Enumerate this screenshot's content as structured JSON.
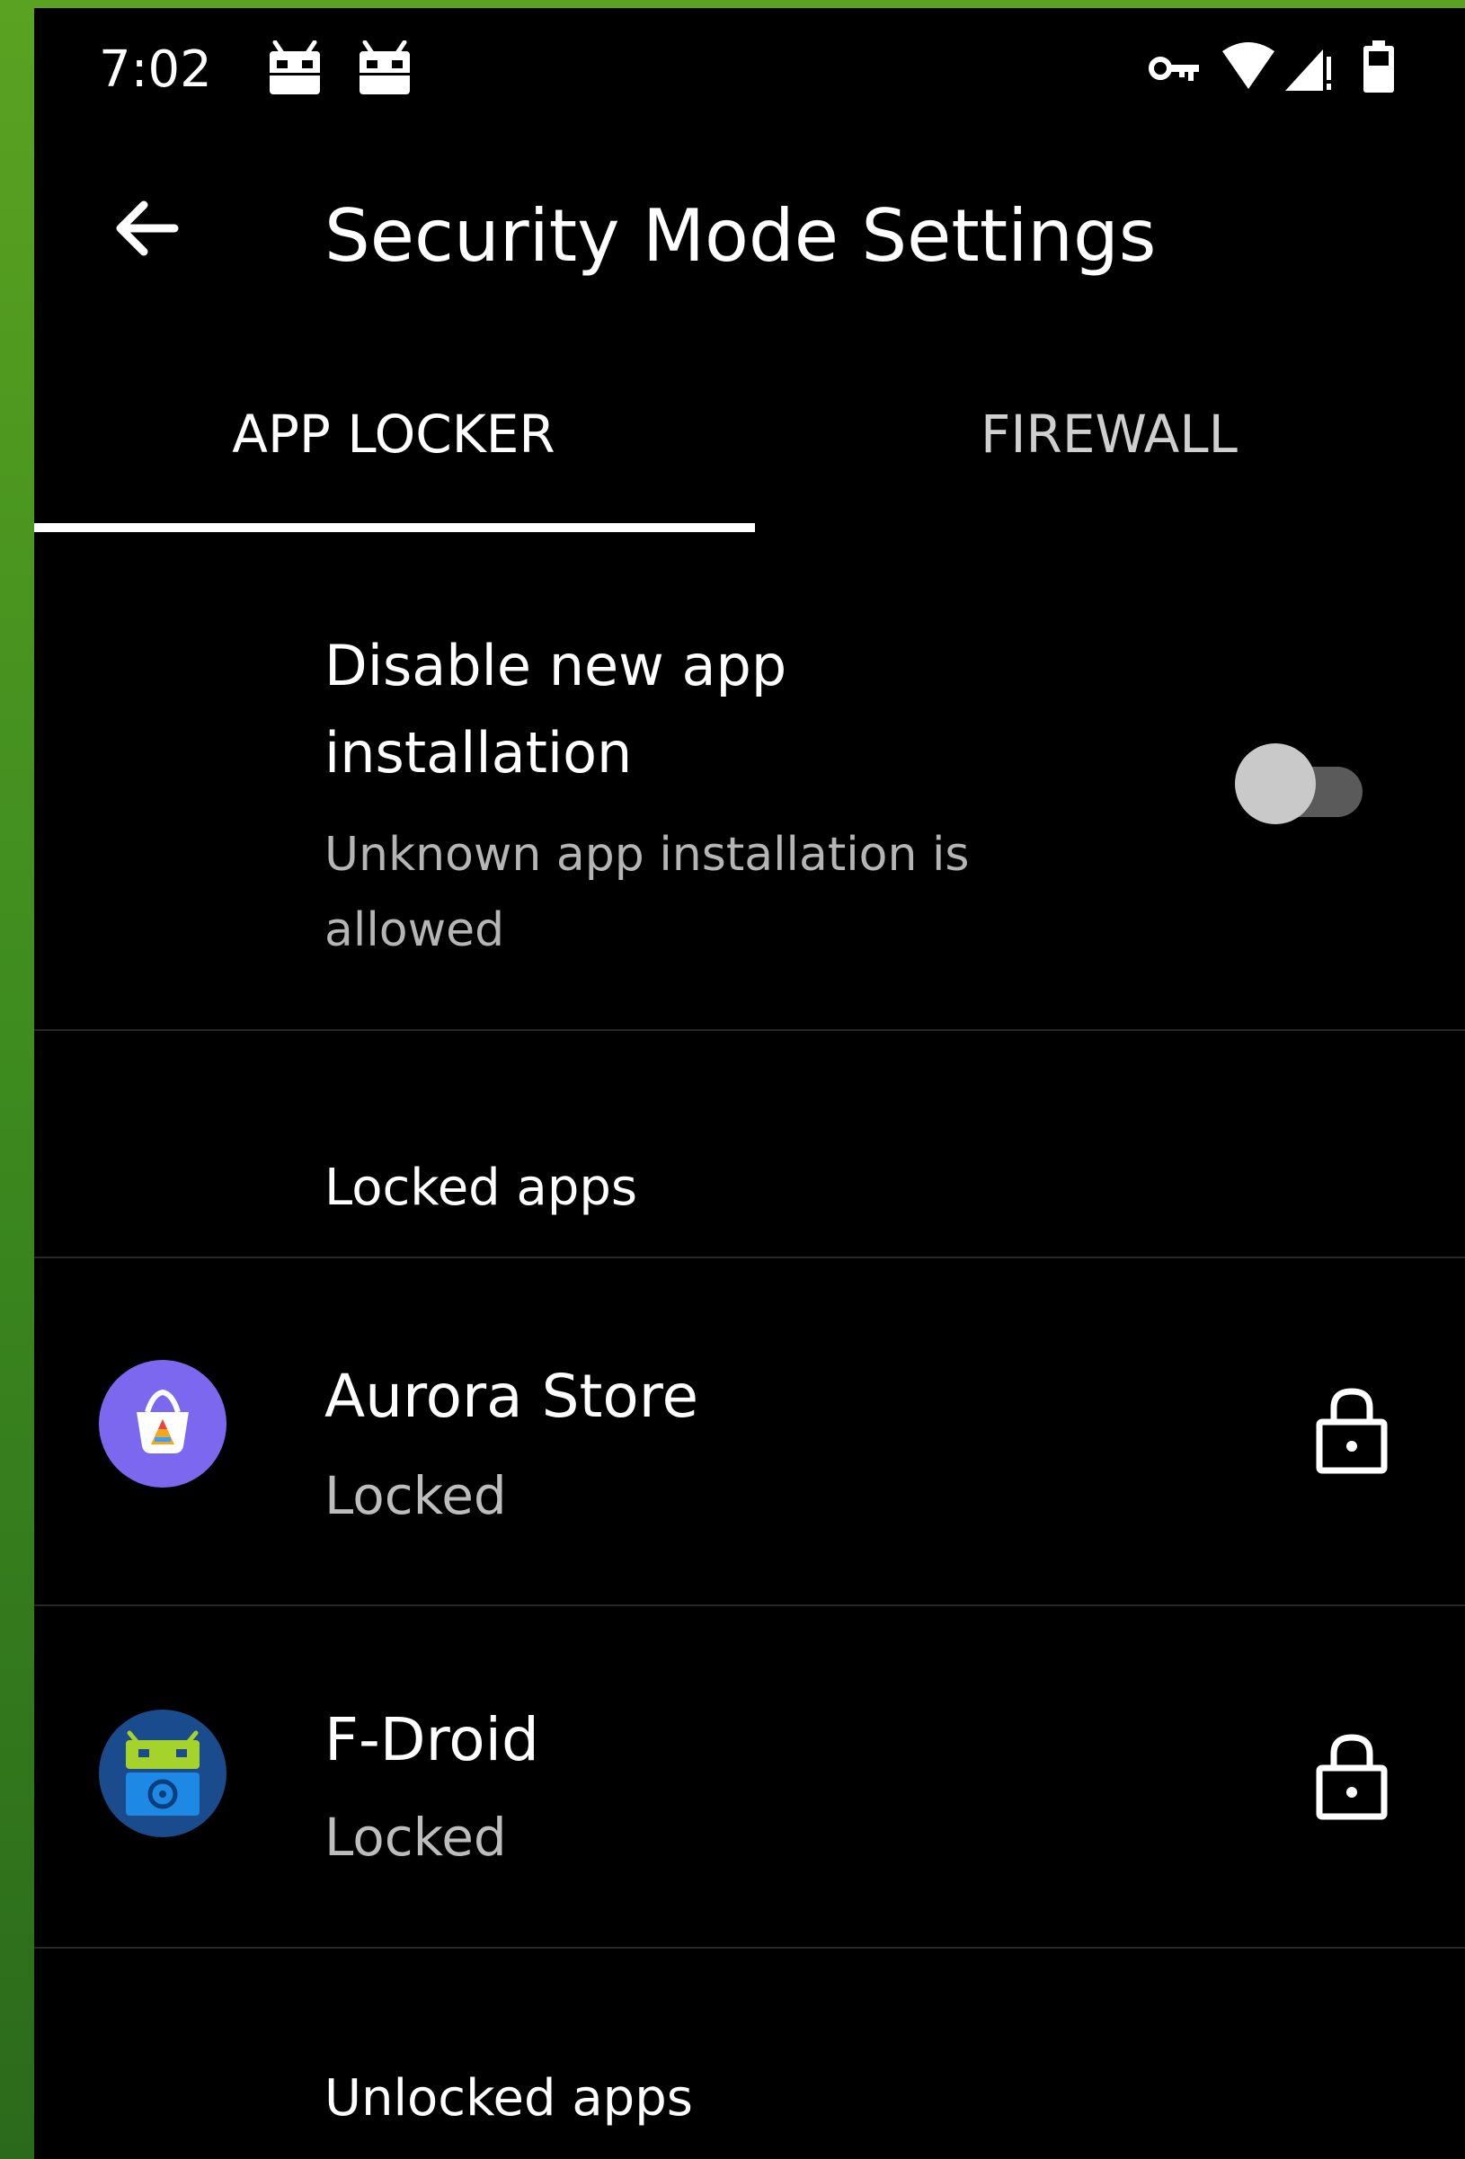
{
  "status_bar": {
    "time": "7:02",
    "notification_icons": [
      "android-notification-icon",
      "android-notification-icon"
    ],
    "system_icons": [
      "vpn-key-icon",
      "wifi-icon",
      "signal-icon",
      "battery-icon"
    ]
  },
  "app_bar": {
    "title": "Security Mode Settings",
    "back_icon": "arrow-back-icon"
  },
  "tabs": [
    {
      "label": "APP LOCKER",
      "selected": true
    },
    {
      "label": "FIREWALL",
      "selected": false
    }
  ],
  "new_app_installation": {
    "title": "Disable new app installation",
    "summary": "Unknown app installation is allowed",
    "enabled": false
  },
  "locked_section": {
    "header": "Locked apps",
    "apps": [
      {
        "name": "Aurora Store",
        "status": "Locked",
        "icon": "aurora-store-icon",
        "action_icon": "lock-icon"
      },
      {
        "name": "F-Droid",
        "status": "Locked",
        "icon": "f-droid-icon",
        "action_icon": "lock-icon"
      }
    ]
  },
  "unlocked_section": {
    "header": "Unlocked apps"
  },
  "colors": {
    "background": "#000000",
    "wallpaper": "#4a9a20",
    "tab_indicator": "#ffffff",
    "secondary_text": "#bdbdbd",
    "aurora_icon_bg": "#7b68ee",
    "fdroid_icon_bg": "#1a4b8c"
  }
}
